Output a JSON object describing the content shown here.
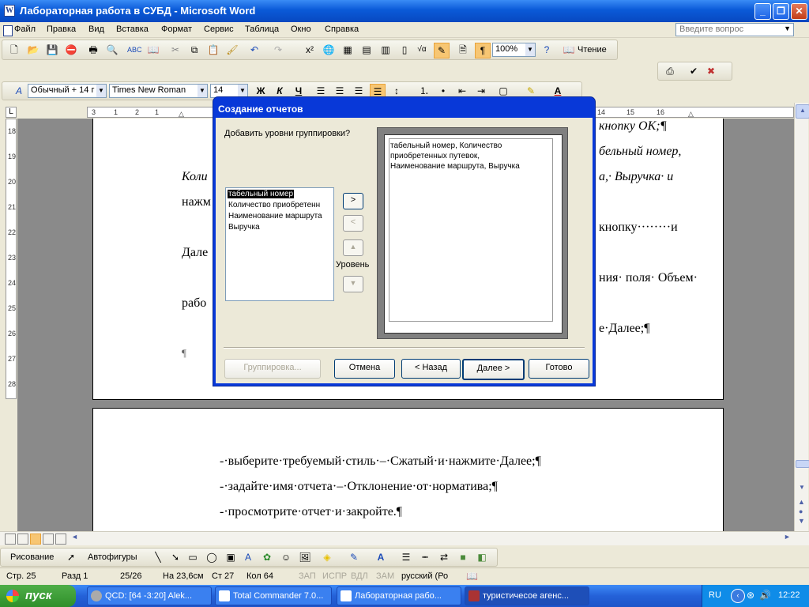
{
  "window": {
    "title": "Лабораторная работа в СУБД - Microsoft Word",
    "app_icon": "W",
    "min": "_",
    "max": "❐",
    "close": "✕"
  },
  "menu": {
    "items": [
      "Файл",
      "Правка",
      "Вид",
      "Вставка",
      "Формат",
      "Сервис",
      "Таблица",
      "Окно",
      "Справка"
    ],
    "help_placeholder": "Введите вопрос"
  },
  "toolbar_std": {
    "zoom": "100%",
    "reading": "Чтение"
  },
  "toolbar_fmt": {
    "style": "Обычный + 14 г",
    "font": "Times New Roman",
    "size": "14",
    "bold": "Ж",
    "italic": "К",
    "underline": "Ч"
  },
  "hruler": {
    "labels": [
      "3",
      "1",
      "2",
      "1",
      "14",
      "15",
      "16"
    ]
  },
  "vruler": {
    "labels": [
      "18",
      "19",
      "20",
      "21",
      "22",
      "23",
      "24",
      "25",
      "26",
      "27",
      "28"
    ]
  },
  "document": {
    "page1_frag": {
      "l1": "кнопку ОК;¶",
      "l2": "бельный номер,",
      "l3a": "Коли",
      "l3b": "а,· Выручка· и",
      "l4a": "нажм",
      "l5b": "кнопку········и",
      "l6a": "Дале",
      "l7b": "ния· поля· Объем·",
      "l8a": "рабо",
      "l9b": "е·Далее;¶",
      "para": "¶"
    },
    "page2": [
      "-·выберите·требуемый·стиль·–·Сжатый·и·нажмите·Далее;¶",
      "-·задайте·имя·отчета·–·Отклонение·от·норматива;¶",
      "-·просмотрите·отчет·и·закройте.¶"
    ]
  },
  "dialog": {
    "title": "Создание отчетов",
    "prompt": "Добавить уровни группировки?",
    "fields": [
      "табельный номер",
      "Количество приобретенн",
      "Наименование маршрута",
      "Выручка"
    ],
    "preview_lines": [
      "табельный номер, Количество",
      "приобретенных путевок,",
      "Наименование маршрута, Выручка"
    ],
    "btn_add": ">",
    "btn_remove": "<",
    "level_label": "Уровень",
    "buttons": {
      "grouping": "Группировка...",
      "cancel": "Отмена",
      "back": "< Назад",
      "next": "Далее >",
      "finish": "Готово"
    }
  },
  "drawbar": {
    "drawing": "Рисование",
    "autoshapes": "Автофигуры"
  },
  "status": {
    "page": "Стр.  25",
    "section": "Разд  1",
    "pages": "25/26",
    "at": "На  23,6см",
    "line": "Ст  27",
    "col": "Кол  64",
    "rec": "ЗАП",
    "trk": "ИСПР",
    "ext": "ВДЛ",
    "ovr": "ЗАМ",
    "lang": "русский (Ро"
  },
  "taskbar": {
    "start": "пуск",
    "tasks": [
      "QCD: [64 -3:20] Alek...",
      "Total Commander 7.0...",
      "Лабораторная рабо...",
      "туристичесое агенс..."
    ],
    "lang": "RU",
    "clock": "12:22"
  },
  "colors": {
    "titlebar": "#0a5ad8",
    "taskbar": "#2461d8",
    "start": "#3a9a33",
    "selection": "#000000"
  }
}
